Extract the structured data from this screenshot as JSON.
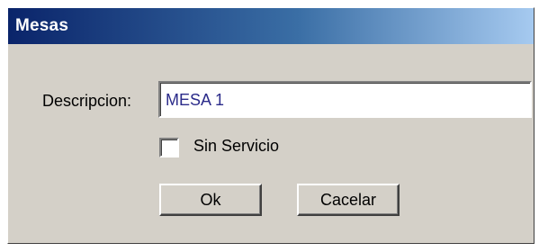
{
  "window": {
    "title": "Mesas"
  },
  "form": {
    "descripcion_label": "Descripcion:",
    "descripcion_value": "MESA 1",
    "sin_servicio_label": "Sin Servicio",
    "sin_servicio_checked": false
  },
  "buttons": {
    "ok_label": "Ok",
    "cancel_label": "Cacelar"
  },
  "colors": {
    "dialog_background": "#d4d0c8",
    "titlebar_start": "#0a246a",
    "titlebar_end": "#a6caf0",
    "input_text": "#2b2b8a"
  }
}
